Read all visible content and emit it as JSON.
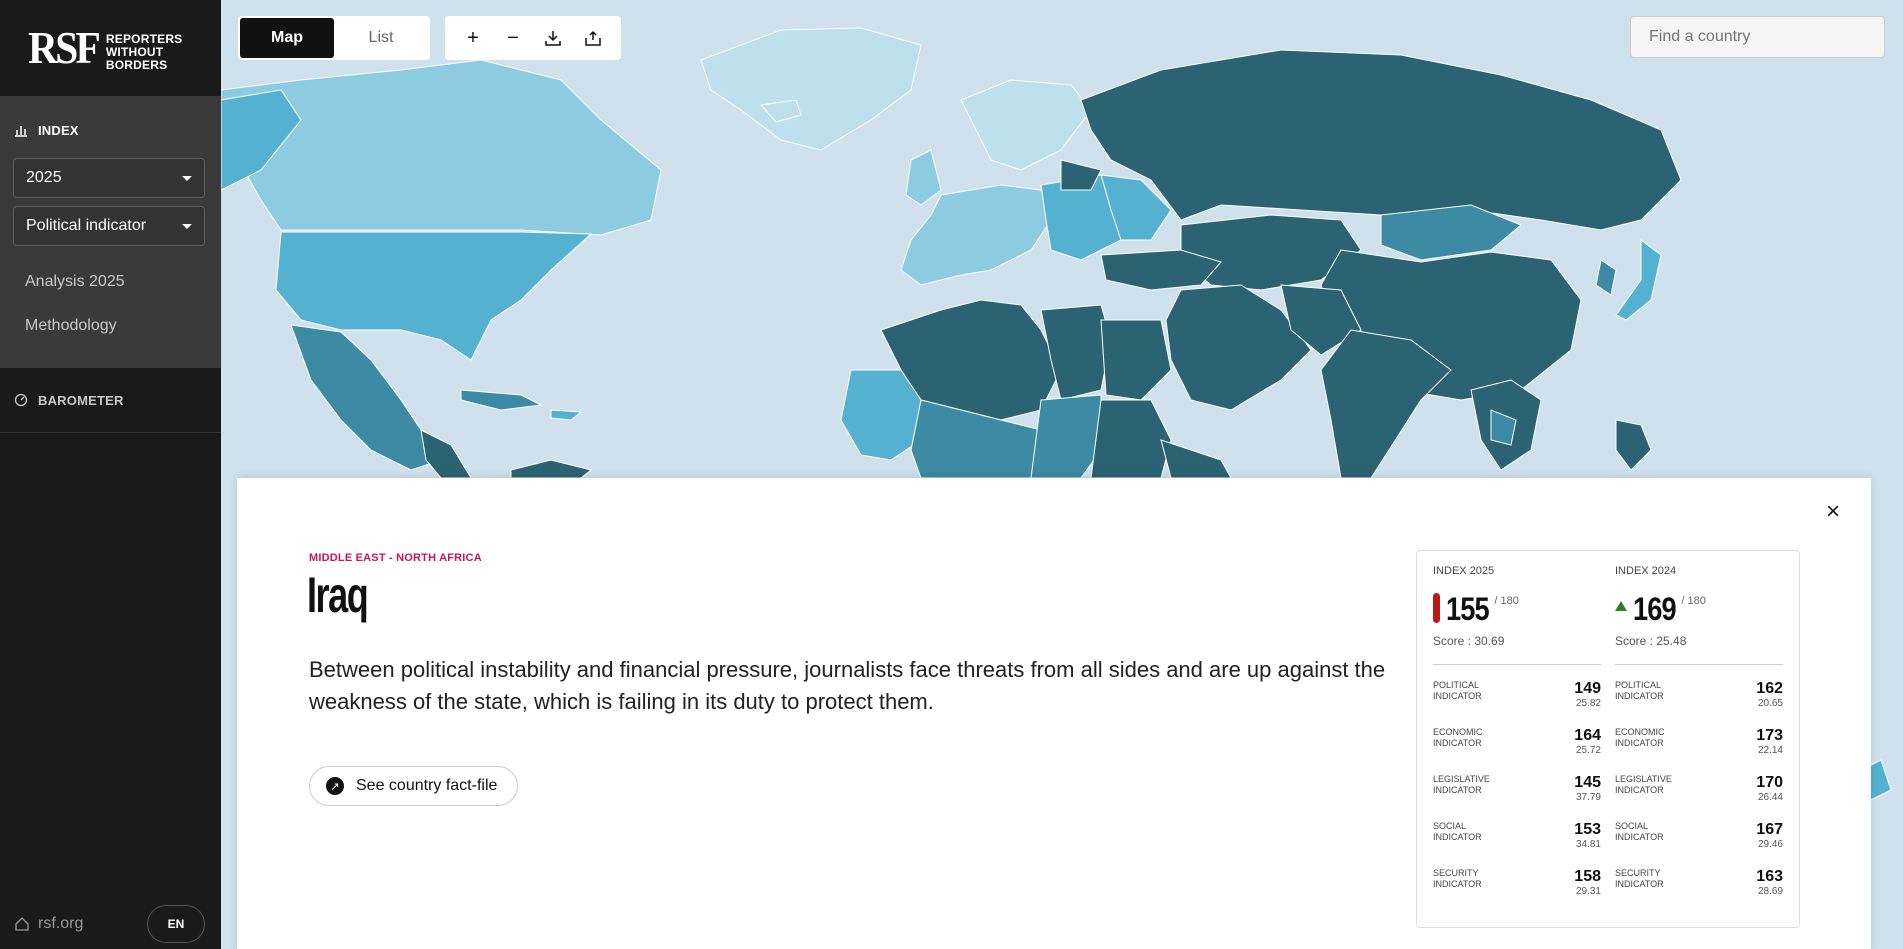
{
  "brand": {
    "mark": "RSF",
    "line1": "REPORTERS",
    "line2": "WITHOUT BORDERS"
  },
  "sidebar": {
    "index_label": "INDEX",
    "year_select": "2025",
    "indicator_select": "Political indicator",
    "links": [
      "Analysis 2025",
      "Methodology"
    ],
    "barometer_label": "BAROMETER",
    "home_link": "rsf.org",
    "lang": "EN"
  },
  "toolbar": {
    "map_label": "Map",
    "list_label": "List"
  },
  "search": {
    "placeholder": "Find a country"
  },
  "country": {
    "region": "MIDDLE EAST - NORTH AFRICA",
    "name": "Iraq",
    "description": "Between political instability and financial pressure, journalists face threats from all sides and are up against the weakness of the state, which is failing in its duty to protect them.",
    "factfile_label": "See country fact-file"
  },
  "index_2025": {
    "header": "INDEX 2025",
    "rank": "155",
    "total": "/ 180",
    "score": "Score : 30.69",
    "indicators": [
      {
        "label": "POLITICAL INDICATOR",
        "rank": "149",
        "score": "25.82"
      },
      {
        "label": "ECONOMIC INDICATOR",
        "rank": "164",
        "score": "25.72"
      },
      {
        "label": "LEGISLATIVE INDICATOR",
        "rank": "145",
        "score": "37.79"
      },
      {
        "label": "SOCIAL INDICATOR",
        "rank": "153",
        "score": "34.81"
      },
      {
        "label": "SECURITY INDICATOR",
        "rank": "158",
        "score": "29.31"
      }
    ]
  },
  "index_2024": {
    "header": "INDEX 2024",
    "rank": "169",
    "total": "/ 180",
    "score": "Score : 25.48",
    "indicators": [
      {
        "label": "POLITICAL INDICATOR",
        "rank": "162",
        "score": "20.65"
      },
      {
        "label": "ECONOMIC INDICATOR",
        "rank": "173",
        "score": "22.14"
      },
      {
        "label": "LEGISLATIVE INDICATOR",
        "rank": "170",
        "score": "26.44"
      },
      {
        "label": "SOCIAL INDICATOR",
        "rank": "167",
        "score": "29.46"
      },
      {
        "label": "SECURITY INDICATOR",
        "rank": "163",
        "score": "28.69"
      }
    ]
  },
  "colors": {
    "very_serious": "#2c6373",
    "difficult": "#3c8aa3",
    "problematic": "#55b1d0",
    "satisfactory": "#8dcbe0",
    "good": "#bde0ec",
    "accent": "#c2185b"
  }
}
